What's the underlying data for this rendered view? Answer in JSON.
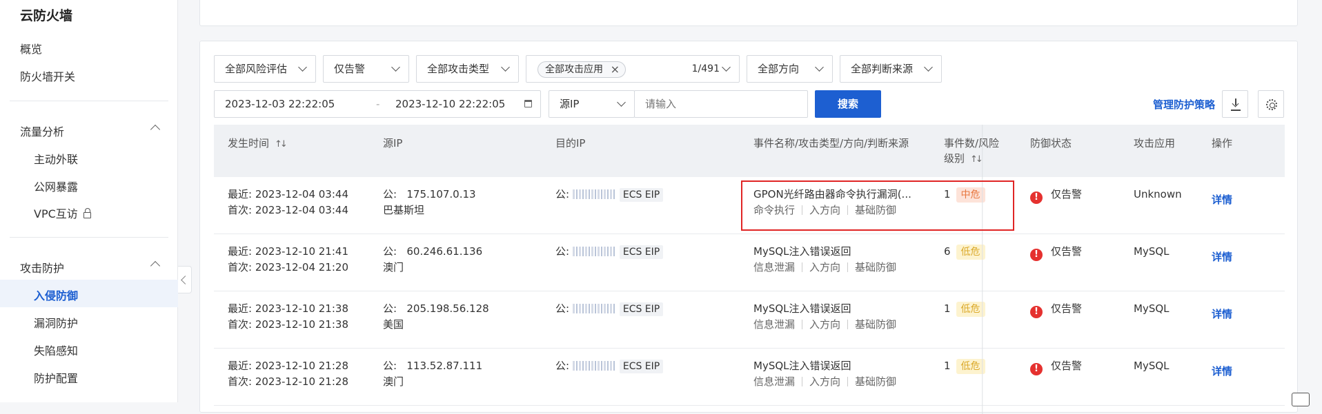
{
  "sidebar": {
    "title": "云防火墙",
    "items": [
      {
        "label": "概览"
      },
      {
        "label": "防火墙开关"
      }
    ],
    "traffic_group": {
      "label": "流量分析",
      "children": [
        {
          "label": "主动外联"
        },
        {
          "label": "公网暴露"
        },
        {
          "label": "VPC互访"
        }
      ]
    },
    "attack_group": {
      "label": "攻击防护",
      "children": [
        {
          "label": "入侵防御"
        },
        {
          "label": "漏洞防护"
        },
        {
          "label": "失陷感知"
        },
        {
          "label": "防护配置"
        }
      ],
      "active": "入侵防御"
    }
  },
  "filters": {
    "risk_eval": "全部风险评估",
    "mode": "仅告警",
    "attack_type": "全部攻击类型",
    "app_chip": "全部攻击应用",
    "app_count": "1/491",
    "direction": "全部方向",
    "source": "全部判断来源",
    "start_time": "2023-12-03 22:22:05",
    "range_sep": "-",
    "end_time": "2023-12-10 22:22:05",
    "ip_type": "源IP",
    "ip_placeholder": "请输入",
    "search_label": "搜索",
    "manage_policy": "管理防护策略"
  },
  "columns": {
    "time": "发生时间",
    "src_ip": "源IP",
    "dst_ip": "目的IP",
    "event": "事件名称/攻击类型/方向/判断来源",
    "count_l1": "事件数/风险",
    "count_l2": "级别",
    "defense": "防御状态",
    "app": "攻击应用",
    "op": "操作"
  },
  "rows": [
    {
      "latest": "最近: 2023-12-04 03:44",
      "first": "首次: 2023-12-04 03:44",
      "src_prefix": "公:",
      "src_ip": "175.107.0.13",
      "src_region": "巴基斯坦",
      "dst_prefix": "公:",
      "dst_tag": "ECS EIP",
      "event_name": "GPON光纤路由器命令执行漏洞(...",
      "attack_type": "命令执行",
      "direction": "入方向",
      "source": "基础防御",
      "count": "1",
      "risk": "中危",
      "defense": "仅告警",
      "app": "Unknown",
      "detail": "详情"
    },
    {
      "latest": "最近: 2023-12-10 21:41",
      "first": "首次: 2023-12-04 21:20",
      "src_prefix": "公:",
      "src_ip": "60.246.61.136",
      "src_region": "澳门",
      "dst_prefix": "公:",
      "dst_tag": "ECS EIP",
      "event_name": "MySQL注入错误返回",
      "attack_type": "信息泄漏",
      "direction": "入方向",
      "source": "基础防御",
      "count": "6",
      "risk": "低危",
      "defense": "仅告警",
      "app": "MySQL",
      "detail": "详情"
    },
    {
      "latest": "最近: 2023-12-10 21:38",
      "first": "首次: 2023-12-10 21:38",
      "src_prefix": "公:",
      "src_ip": "205.198.56.128",
      "src_region": "美国",
      "dst_prefix": "公:",
      "dst_tag": "ECS EIP",
      "event_name": "MySQL注入错误返回",
      "attack_type": "信息泄漏",
      "direction": "入方向",
      "source": "基础防御",
      "count": "1",
      "risk": "低危",
      "defense": "仅告警",
      "app": "MySQL",
      "detail": "详情"
    },
    {
      "latest": "最近: 2023-12-10 21:28",
      "first": "首次: 2023-12-10 21:28",
      "src_prefix": "公:",
      "src_ip": "113.52.87.111",
      "src_region": "澳门",
      "dst_prefix": "公:",
      "dst_tag": "ECS EIP",
      "event_name": "MySQL注入错误返回",
      "attack_type": "信息泄漏",
      "direction": "入方向",
      "source": "基础防御",
      "count": "1",
      "risk": "低危",
      "defense": "仅告警",
      "app": "MySQL",
      "detail": "详情"
    }
  ],
  "colors": {
    "primary": "#1d5fd1",
    "danger": "#e5312f",
    "highlight": "#e02424",
    "risk_mid_bg": "#fde3d9",
    "risk_low_bg": "#fdf3cf"
  }
}
